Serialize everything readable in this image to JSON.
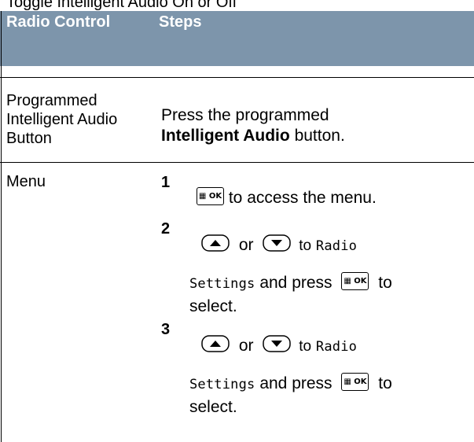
{
  "header_text": "Toggle Intelligent Audio On or Off",
  "table": {
    "headers": [
      "Radio Control",
      "Steps"
    ],
    "row1": {
      "control": "Programmed Intelligent Audio Button",
      "step_text_before": "Press the programmed",
      "step_bold": "Intelligent Audio",
      "step_text_after": "button."
    },
    "row2": {
      "control": "Menu",
      "steps": [
        {
          "num": "1",
          "key": "OK",
          "text": "to access the menu."
        },
        {
          "num": "2",
          "or": "or",
          "to": "to",
          "mono1": "Radio",
          "mono2": "Settings",
          "and_press": "and press",
          "key": "OK",
          "to2": "to",
          "select": "select."
        },
        {
          "num": "3",
          "or": "or",
          "to": "to",
          "mono1": "Radio",
          "mono2": "Settings",
          "and_press": "and press",
          "key": "OK",
          "to2": "to",
          "select": "select."
        }
      ]
    }
  },
  "icons": {
    "ok_key": "menu-ok-key-icon",
    "up_key": "up-arrow-key-icon",
    "down_key": "down-arrow-key-icon"
  },
  "colors": {
    "header_bg": "#7d95ab",
    "header_text": "#ffffff"
  }
}
